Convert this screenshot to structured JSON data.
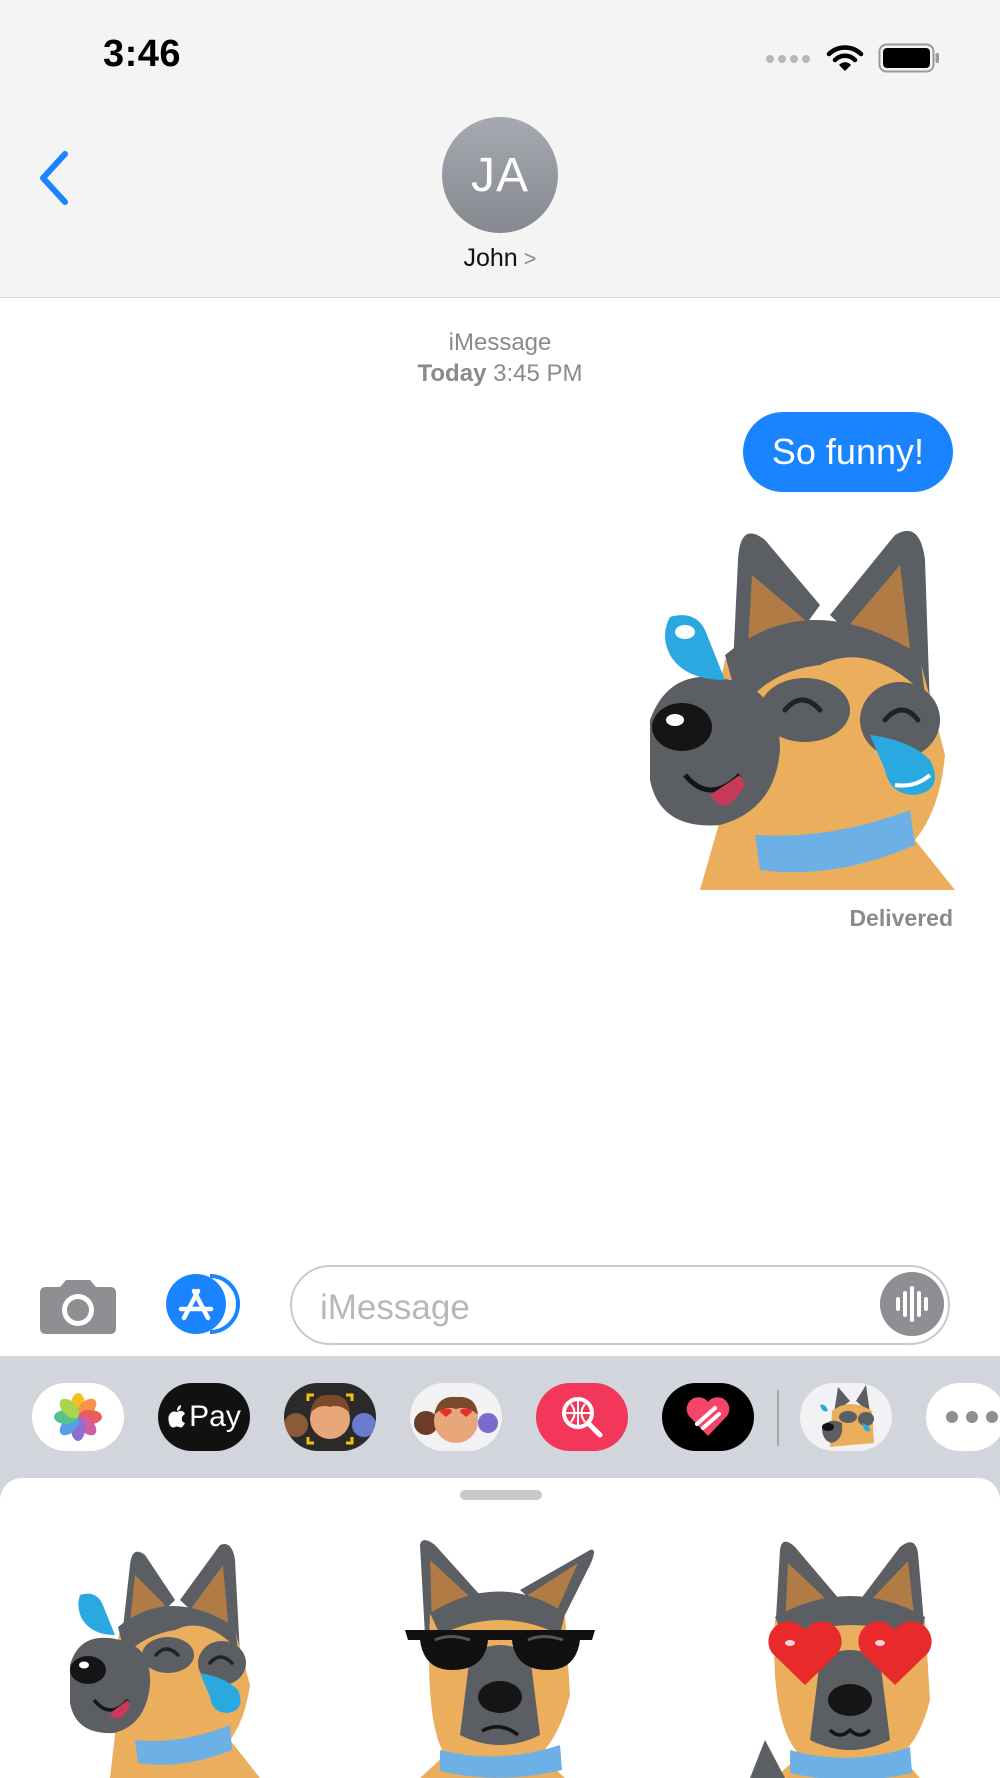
{
  "status_bar": {
    "time": "3:46",
    "icons": [
      "cellular-signal-icon",
      "wifi-icon",
      "battery-icon"
    ]
  },
  "header": {
    "back_icon": "chevron-left-icon",
    "avatar_initials": "JA",
    "contact_name": "John",
    "contact_chevron": ">"
  },
  "conversation": {
    "service_label": "iMessage",
    "timestamp_day": "Today",
    "timestamp_time": "3:45 PM",
    "messages": [
      {
        "type": "text",
        "from": "me",
        "text": "So funny!"
      },
      {
        "type": "sticker",
        "from": "me",
        "sticker": "dog-laughing-tears-sticker"
      }
    ],
    "delivery_status": "Delivered"
  },
  "input_bar": {
    "camera_icon": "camera-icon",
    "apps_icon": "app-store-icon",
    "placeholder": "iMessage",
    "audio_icon": "audio-waveform-icon"
  },
  "app_drawer": {
    "apps": [
      {
        "name": "photos-app-icon"
      },
      {
        "name": "apple-pay-app-icon",
        "label": "Pay"
      },
      {
        "name": "memoji-app-icon"
      },
      {
        "name": "memoji-stickers-app-icon"
      },
      {
        "name": "images-search-app-icon"
      },
      {
        "name": "digital-touch-app-icon"
      },
      {
        "name": "dog-stickers-app-icon"
      },
      {
        "name": "more-apps-icon"
      }
    ],
    "stickers": [
      "dog-laughing-tears-sticker",
      "dog-sunglasses-sticker",
      "dog-heart-eyes-sticker"
    ]
  },
  "colors": {
    "accent_blue": "#1a84ff",
    "header_bg": "#f4f4f4",
    "secondary_text": "#8a8a8e",
    "tray_bg": "#d3d5dc"
  }
}
